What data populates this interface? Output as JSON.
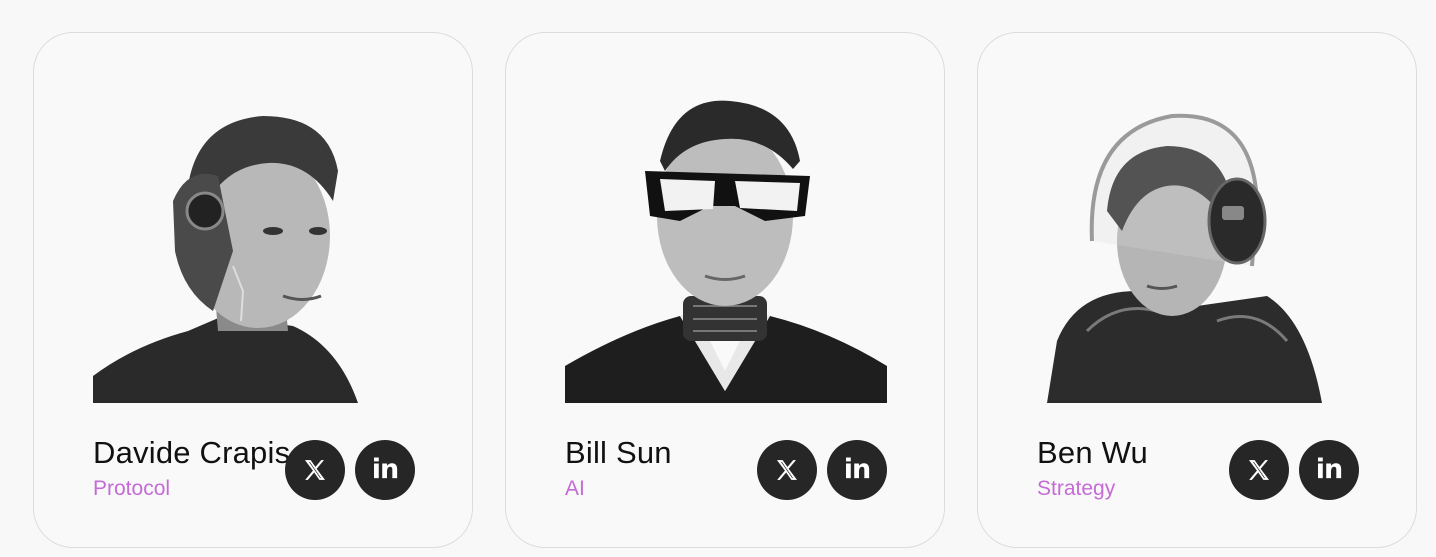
{
  "team": [
    {
      "name": "Davide Crapis",
      "role": "Protocol",
      "portrait_icon": "person-portrait-cyborg-headset",
      "social": [
        {
          "icon": "x-icon",
          "label": "𝕏"
        },
        {
          "icon": "linkedin-icon",
          "label": "in"
        }
      ]
    },
    {
      "name": "Bill Sun",
      "role": "AI",
      "portrait_icon": "person-portrait-visor-glasses",
      "social": [
        {
          "icon": "x-icon",
          "label": "𝕏"
        },
        {
          "icon": "linkedin-icon",
          "label": "in"
        }
      ]
    },
    {
      "name": "Ben Wu",
      "role": "Strategy",
      "portrait_icon": "person-portrait-helmet-headphones",
      "social": [
        {
          "icon": "x-icon",
          "label": "𝕏"
        },
        {
          "icon": "linkedin-icon",
          "label": "in"
        }
      ]
    }
  ],
  "colors": {
    "page_bg": "#f8f8f8",
    "card_border": "#dcdcdc",
    "role_text": "#c56bd6",
    "social_bg": "#262626",
    "name_text": "#111111"
  }
}
